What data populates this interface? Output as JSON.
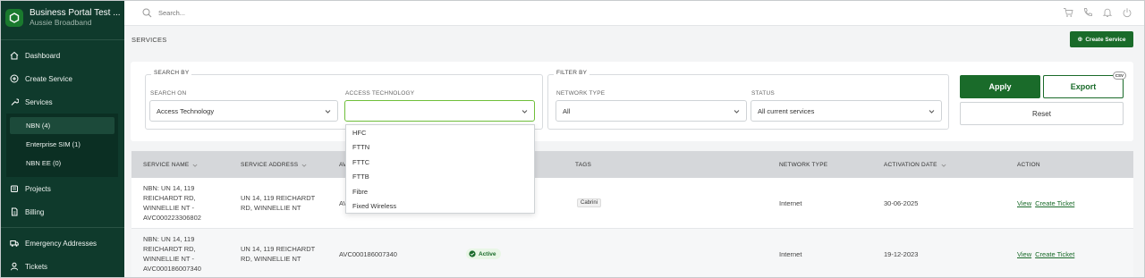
{
  "sidebar": {
    "brand_title": "Business Portal Test ...",
    "brand_subtitle": "Aussie Broadband",
    "items": [
      {
        "label": "Dashboard",
        "icon": "home-icon"
      },
      {
        "label": "Create Service",
        "icon": "plus-circle-icon"
      },
      {
        "label": "Services",
        "icon": "wrench-icon"
      },
      {
        "label": "Projects",
        "icon": "folder-icon"
      },
      {
        "label": "Billing",
        "icon": "document-icon"
      },
      {
        "label": "Emergency Addresses",
        "icon": "truck-icon"
      },
      {
        "label": "Tickets",
        "icon": "user-icon"
      }
    ],
    "services_sub": [
      {
        "label": "NBN (4)",
        "active": true
      },
      {
        "label": "Enterprise SIM (1)",
        "active": false
      },
      {
        "label": "NBN EE (0)",
        "active": false
      }
    ]
  },
  "topbar": {
    "search_placeholder": "Search...",
    "icons": [
      "cart-icon",
      "phone-icon",
      "bell-icon",
      "power-icon"
    ]
  },
  "page": {
    "title": "SERVICES",
    "create_button": "Create Service"
  },
  "filters": {
    "search_by_legend": "SEARCH BY",
    "filter_by_legend": "FILTER BY",
    "search_on_label": "SEARCH ON",
    "search_on_value": "Access Technology",
    "access_tech_label": "ACCESS TECHNOLOGY",
    "access_tech_value": "",
    "network_type_label": "NETWORK TYPE",
    "network_type_value": "All",
    "status_label": "STATUS",
    "status_value": "All current services",
    "apply": "Apply",
    "export": "Export",
    "csv": "CSV",
    "reset": "Reset"
  },
  "dropdown": {
    "options": [
      "HFC",
      "FTTN",
      "FTTC",
      "FTTB",
      "Fibre",
      "Fixed Wireless"
    ]
  },
  "table": {
    "headers": {
      "service_name": "SERVICE NAME",
      "service_address": "SERVICE ADDRESS",
      "avc": "AV",
      "tags": "TAGS",
      "network_type": "NETWORK TYPE",
      "activation_date": "ACTIVATION DATE",
      "action": "ACTION"
    },
    "rows": [
      {
        "name": [
          "NBN: UN 14, 119",
          "REICHARDT RD,",
          "WINNELLIE NT -",
          "AVC000223306802"
        ],
        "address": [
          "UN 14, 119 REICHARDT",
          "RD, WINNELLIE NT"
        ],
        "avc": "AV",
        "status": "",
        "tag": "Cabrini",
        "network_type": "Internet",
        "activation_date": "30-06-2025",
        "view": "View",
        "create_ticket": "Create Ticket"
      },
      {
        "name": [
          "NBN: UN 14, 119",
          "REICHARDT RD,",
          "WINNELLIE NT -",
          "AVC000186007340"
        ],
        "address": [
          "UN 14, 119 REICHARDT",
          "RD, WINNELLIE NT"
        ],
        "avc": "AVC000186007340",
        "status": "Active",
        "tag": "",
        "network_type": "Internet",
        "activation_date": "19-12-2023",
        "view": "View",
        "create_ticket": "Create Ticket"
      }
    ]
  },
  "colors": {
    "sidebar_bg": "#0f3a2c",
    "primary": "#1a6b2a",
    "focus": "#6fbf3a"
  }
}
